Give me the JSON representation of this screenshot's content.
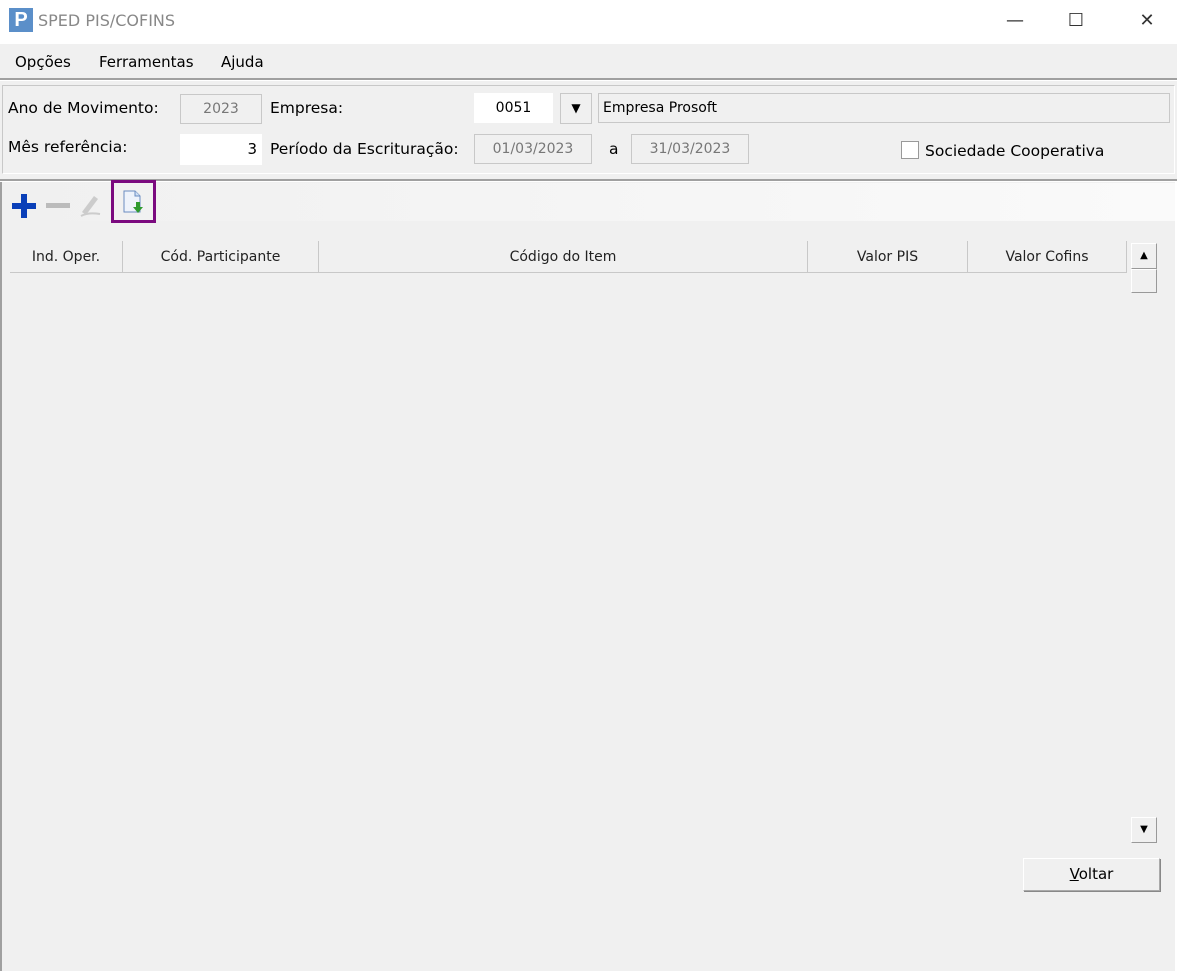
{
  "window": {
    "title": "SPED PIS/COFINS",
    "logo": "P",
    "minimize": "—",
    "maximize": "☐",
    "close": "✕"
  },
  "menu": [
    "Opções",
    "Ferramentas",
    "Ajuda"
  ],
  "form": {
    "ano_label": "Ano de Movimento:",
    "ano_value": "2023",
    "empresa_label": "Empresa:",
    "empresa_code": "0051",
    "empresa_name": "Empresa Prosoft",
    "mes_label": "Mês referência:",
    "mes_value": "3",
    "periodo_label": "Período da Escrituração:",
    "periodo_inicio": "01/03/2023",
    "periodo_sep": "a",
    "periodo_fim": "31/03/2023",
    "cooperativa_label": "Sociedade Cooperativa",
    "cooperativa_checked": false
  },
  "toolbar": {
    "icons": [
      "plus-icon",
      "minus-icon",
      "pencil-icon",
      "import-document-icon"
    ]
  },
  "table": {
    "columns": [
      "Ind. Oper.",
      "Cód. Participante",
      "Código do Item",
      "Valor PIS",
      "Valor Cofins"
    ],
    "rows": []
  },
  "buttons": {
    "voltar": "Voltar"
  },
  "colors": {
    "highlight": "#7b0a7f",
    "accent": "#0a4fd0"
  }
}
